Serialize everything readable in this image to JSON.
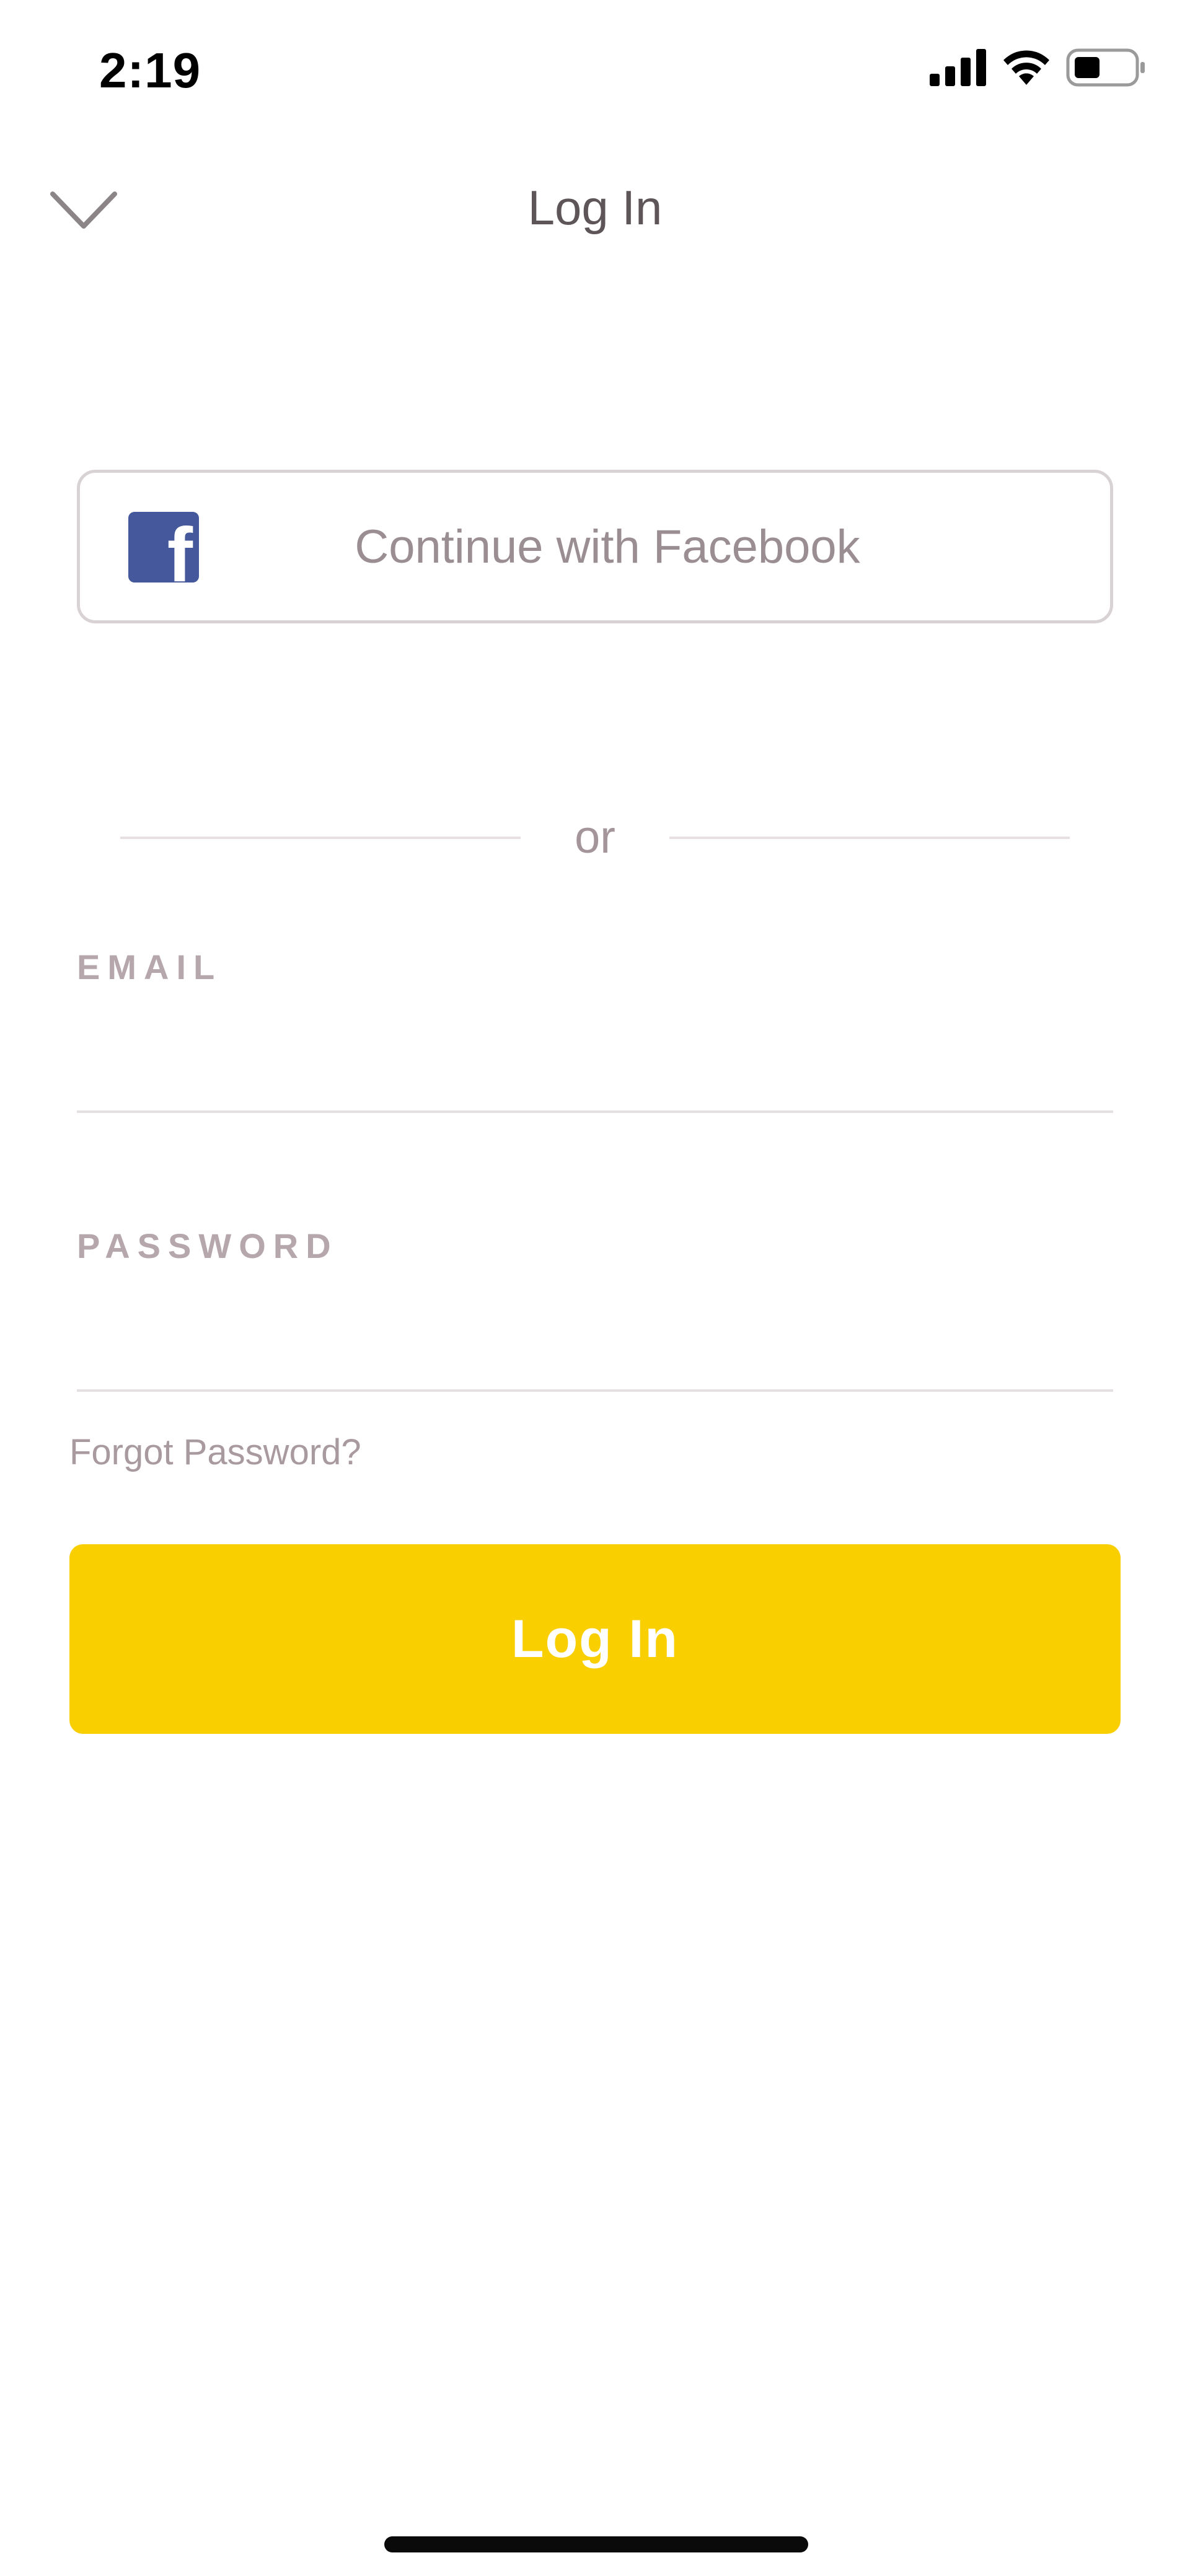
{
  "status_bar": {
    "time": "2:19",
    "icons": [
      "signal-icon",
      "wifi-icon",
      "battery-icon"
    ]
  },
  "nav": {
    "title": "Log In",
    "close_icon": "chevron-down-icon"
  },
  "facebook_button": {
    "label": "Continue with Facebook",
    "icon": "facebook-icon",
    "logo_letter": "f",
    "brand_color": "#44589b"
  },
  "divider": {
    "text": "or"
  },
  "email": {
    "label": "EMAIL",
    "value": "",
    "placeholder": ""
  },
  "password": {
    "label": "PASSWORD",
    "value": "",
    "placeholder": ""
  },
  "forgot_password": {
    "label": "Forgot Password?"
  },
  "login_button": {
    "label": "Log In",
    "color": "#f9cf00"
  },
  "colors": {
    "accent": "#f9cf00",
    "muted_text": "#9b8e92",
    "title_text": "#5e5558"
  }
}
